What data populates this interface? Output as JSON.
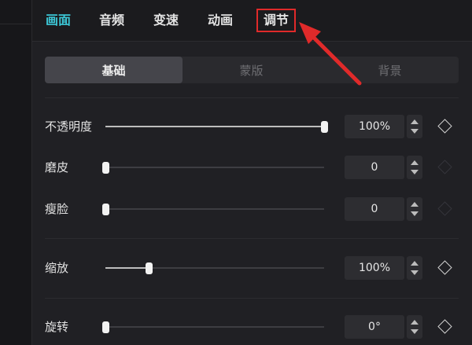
{
  "tabs": [
    {
      "label": "画面",
      "active": true
    },
    {
      "label": "音频"
    },
    {
      "label": "变速"
    },
    {
      "label": "动画"
    },
    {
      "label": "调节",
      "highlighted": true
    }
  ],
  "subtabs": [
    {
      "label": "基础",
      "active": true
    },
    {
      "label": "蒙版"
    },
    {
      "label": "背景"
    }
  ],
  "controls": {
    "opacity": {
      "label": "不透明度",
      "value": "100%",
      "level": 1.0
    },
    "smooth": {
      "label": "磨皮",
      "value": "0",
      "level": 0.0
    },
    "slim": {
      "label": "瘦脸",
      "value": "0",
      "level": 0.0
    },
    "scale": {
      "label": "缩放",
      "value": "100%",
      "level": 0.2
    },
    "rotate": {
      "label": "旋转",
      "value": "0°",
      "level": 0.0
    }
  },
  "colors": {
    "accent": "#3cc7d6",
    "highlight_box": "#e02a2a",
    "arrow": "#e02a2a"
  }
}
